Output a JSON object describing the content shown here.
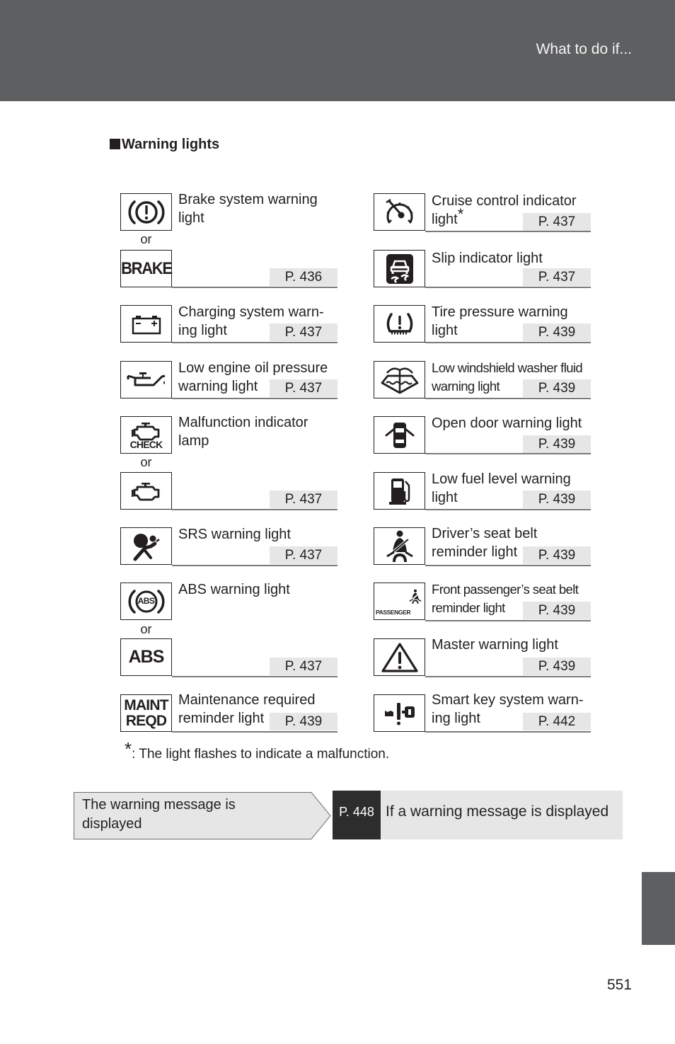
{
  "header": {
    "section": "What to do if..."
  },
  "page": {
    "title": "Warning lights",
    "number": "551"
  },
  "or_label": "or",
  "left_column": [
    {
      "id": "brake",
      "label_lines": [
        "Brake system warning",
        "light"
      ],
      "page": "P. 436",
      "icons": [
        "brake-circle-icon",
        "brake-text-icon"
      ],
      "icon_text": [
        "",
        "BRAKE"
      ]
    },
    {
      "id": "charging",
      "label_lines": [
        "Charging system warn-",
        "ing light"
      ],
      "page": "P. 437",
      "icons": [
        "battery-icon"
      ]
    },
    {
      "id": "oil",
      "label_lines": [
        "Low engine oil pressure",
        "warning light"
      ],
      "page": "P. 437",
      "icons": [
        "oil-can-icon"
      ]
    },
    {
      "id": "malfunction",
      "label_lines": [
        "Malfunction indicator",
        "lamp"
      ],
      "page": "P. 437",
      "icons": [
        "check-engine-icon",
        "engine-icon"
      ],
      "icon_text": [
        "CHECK",
        ""
      ]
    },
    {
      "id": "srs",
      "label_lines": [
        "SRS warning light",
        ""
      ],
      "page": "P. 437",
      "icons": [
        "airbag-icon"
      ]
    },
    {
      "id": "abs",
      "label_lines": [
        "ABS warning light",
        ""
      ],
      "page": "P. 437",
      "icons": [
        "abs-circle-icon",
        "abs-text-icon"
      ],
      "icon_text": [
        "ABS",
        "ABS"
      ]
    },
    {
      "id": "maint",
      "label_lines": [
        "Maintenance required",
        "reminder light"
      ],
      "page": "P. 439",
      "icons": [
        "maint-reqd-icon"
      ],
      "icon_text": [
        "MAINT",
        "REQD"
      ]
    }
  ],
  "right_column": [
    {
      "id": "cruise",
      "label_lines": [
        "Cruise control indicator",
        "light"
      ],
      "superscript": "*",
      "page": "P. 437",
      "icons": [
        "cruise-control-icon"
      ]
    },
    {
      "id": "slip",
      "label_lines": [
        "Slip indicator light",
        ""
      ],
      "page": "P. 437",
      "icons": [
        "slip-icon"
      ]
    },
    {
      "id": "tire",
      "label_lines": [
        "Tire pressure warning",
        "light"
      ],
      "page": "P. 439",
      "icons": [
        "tire-pressure-icon"
      ]
    },
    {
      "id": "washer",
      "label_lines": [
        "Low windshield washer fluid",
        "warning light"
      ],
      "page": "P. 439",
      "icons": [
        "washer-fluid-icon"
      ]
    },
    {
      "id": "door",
      "label_lines": [
        "Open door warning light",
        ""
      ],
      "page": "P. 439",
      "icons": [
        "open-door-icon"
      ]
    },
    {
      "id": "fuel",
      "label_lines": [
        "Low fuel level warning",
        "light"
      ],
      "page": "P. 439",
      "icons": [
        "fuel-pump-icon"
      ]
    },
    {
      "id": "driver_belt",
      "label_lines": [
        "Driver’s seat belt",
        "reminder light"
      ],
      "page": "P. 439",
      "icons": [
        "seat-belt-icon"
      ]
    },
    {
      "id": "passenger_belt",
      "label_lines": [
        "Front passenger’s seat belt",
        "reminder light"
      ],
      "page": "P. 439",
      "icons": [
        "passenger-seat-belt-icon"
      ],
      "icon_text": [
        "PASSENGER"
      ]
    },
    {
      "id": "master",
      "label_lines": [
        "Master warning light",
        ""
      ],
      "page": "P. 439",
      "icons": [
        "master-warning-icon"
      ]
    },
    {
      "id": "smart_key",
      "label_lines": [
        "Smart key system warn-",
        "ing light"
      ],
      "page": "P. 442",
      "icons": [
        "smart-key-icon"
      ]
    }
  ],
  "footnote": {
    "symbol": "*",
    "text": ": The light flashes to indicate a malfunction."
  },
  "message_row": {
    "condition_lines": [
      "The warning message is",
      "displayed"
    ],
    "page": "P. 448",
    "action": "If a warning message is displayed"
  },
  "colors": {
    "header_bg": "#5e5f61",
    "page_ref_bg": "#e6e6e6",
    "dark_ref_bg": "#2d2d2e"
  }
}
